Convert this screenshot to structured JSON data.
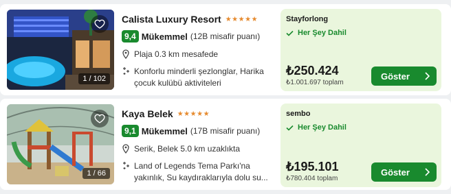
{
  "hotels": [
    {
      "name": "Calista Luxury Resort",
      "stars": "★★★★★",
      "score": "9,4",
      "rating_label": "Mükemmel",
      "rating_count": "(12B misafir puanı)",
      "distance": "Plaja 0.3 km mesafede",
      "feature": "Konforlu minderli şezlonglar, Harika çocuk kulübü aktiviteleri",
      "photo_counter": "1 / 102",
      "provider": "Stayforlong",
      "included": "Her Şey Dahil",
      "price": "₺250.424",
      "total": "₺1.001.697 toplam",
      "button": "Göster"
    },
    {
      "name": "Kaya Belek",
      "stars": "★★★★★",
      "score": "9,1",
      "rating_label": "Mükemmel",
      "rating_count": "(17B misafir puanı)",
      "distance": "Serik, Belek 5.0 km uzaklıkta",
      "feature": "Land of Legends Tema Parkı'na yakınlık, Su kaydıraklarıyla dolu su...",
      "photo_counter": "1 / 66",
      "provider": "sembo",
      "included": "Her Şey Dahil",
      "price": "₺195.101",
      "total": "₺780.404 toplam",
      "button": "Göster"
    }
  ],
  "icons": {
    "favorite": "heart-icon",
    "distance": "location-pin-icon",
    "feature": "sparkle-icon",
    "included": "checkmark-icon",
    "button": "chevron-right-icon"
  },
  "colors": {
    "accent_green": "#198a2e",
    "deal_background": "#eaf6dd",
    "stars": "#e68a2e"
  }
}
